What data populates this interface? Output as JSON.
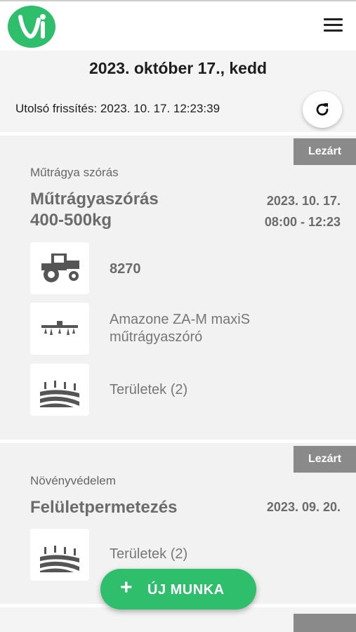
{
  "header": {
    "logo_icon": "vi-logo",
    "menu_icon": "hamburger-menu-icon",
    "accent_color": "#2fbf6c"
  },
  "date_title": "2023. október 17., kedd",
  "last_refresh": "Utolsó frissítés: 2023. 10. 17. 12:23:39",
  "refresh_icon": "refresh-icon",
  "cards": [
    {
      "status": "Lezárt",
      "category": "Műtrágya szórás",
      "title_line1": "Műtrágyaszórás",
      "title_line2": "400-500kg",
      "date": "2023. 10. 17.",
      "time": "08:00 - 12:23",
      "rows": [
        {
          "icon": "tractor-icon",
          "text": "8270"
        },
        {
          "icon": "spreader-icon",
          "text_line1": "Amazone ZA-M maxiS",
          "text_line2": "műtrágyaszóró"
        },
        {
          "icon": "field-icon",
          "text": "Területek (2)"
        }
      ]
    },
    {
      "status": "Lezárt",
      "category": "Növényvédelem",
      "title_line1": "Felületpermetezés",
      "date": "2023. 09. 20.",
      "rows": [
        {
          "icon": "field-icon",
          "text": "Területek (2)"
        }
      ]
    }
  ],
  "fab": {
    "icon": "plus-icon",
    "plus_glyph": "+",
    "label": "ÚJ MUNKA"
  },
  "status_colors": {
    "closed_badge": "#8a8a8a"
  }
}
